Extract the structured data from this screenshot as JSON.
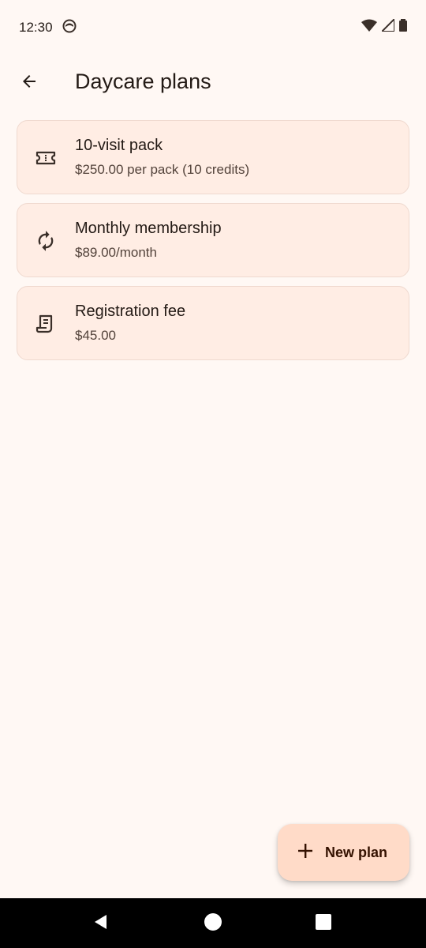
{
  "status_bar": {
    "time": "12:30"
  },
  "header": {
    "title": "Daycare plans",
    "back_icon": "arrow-back-icon"
  },
  "plans": [
    {
      "title": "10-visit pack",
      "subtitle": "$250.00 per pack (10 credits)",
      "icon": "ticket-icon"
    },
    {
      "title": "Monthly membership",
      "subtitle": "$89.00/month",
      "icon": "autorenew-icon"
    },
    {
      "title": "Registration fee",
      "subtitle": "$45.00",
      "icon": "receipt-icon"
    }
  ],
  "fab": {
    "label": "New plan",
    "icon": "plus-icon"
  },
  "colors": {
    "background": "#fff8f4",
    "card": "#ffede4",
    "card_border": "#efd9cf",
    "fab": "#ffdbc8",
    "text": "#231a15"
  }
}
